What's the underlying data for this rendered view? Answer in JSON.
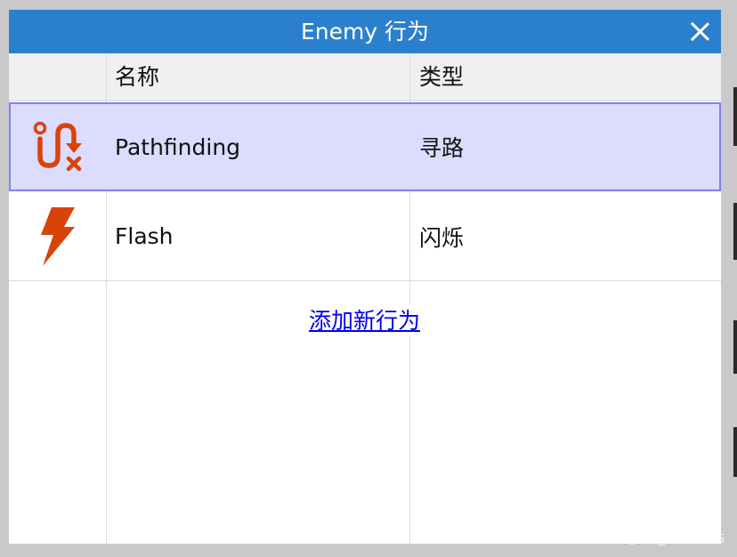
{
  "dialog": {
    "title": "Enemy 行为",
    "close_label": "close"
  },
  "table": {
    "headers": [
      "名称",
      "类型"
    ],
    "rows": [
      {
        "icon": "pathfinding-icon",
        "name": "Pathfinding",
        "type": "寻路",
        "selected": true
      },
      {
        "icon": "lightning-icon",
        "name": "Flash",
        "type": "闪烁",
        "selected": false
      }
    ]
  },
  "add_link": "添加新行为",
  "watermark": "CSDN @m0_72501295",
  "colors": {
    "titlebar": "#2b80cd",
    "selection": "#dcdcff",
    "selection_border": "#8080ee",
    "icon_orange": "#d8430c",
    "link": "#0000ee"
  }
}
